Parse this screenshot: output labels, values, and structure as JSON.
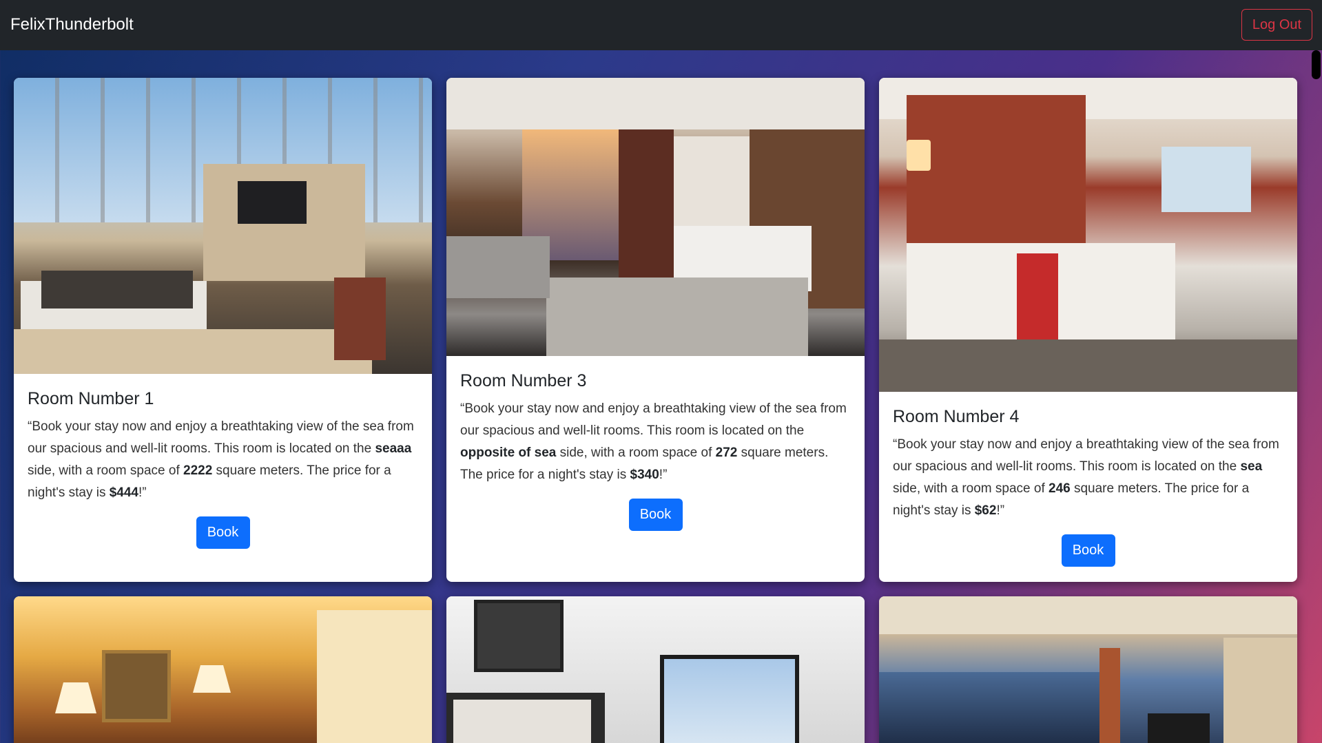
{
  "navbar": {
    "brand": "FelixThunderbolt",
    "logout_label": "Log Out"
  },
  "accent_colors": {
    "primary": "#0d6efd",
    "danger": "#dc3545",
    "navbar": "#212529"
  },
  "rooms": [
    {
      "title": "Room Number 1",
      "text_a": "“Book your stay now and enjoy a breathtaking view of the sea from our spacious and well-lit rooms. This room is located on the ",
      "side": "seaaa",
      "text_b": " side, with a room space of ",
      "space": "2222",
      "text_c": " square meters. The price for a night's stay is ",
      "price": "$444",
      "text_d": "!”",
      "button": "Book"
    },
    {
      "title": "Room Number 3",
      "text_a": "“Book your stay now and enjoy a breathtaking view of the sea from our spacious and well-lit rooms. This room is located on the ",
      "side": "opposite of sea",
      "text_b": " side, with a room space of ",
      "space": "272",
      "text_c": " square meters. The price for a night's stay is ",
      "price": "$340",
      "text_d": "!”",
      "button": "Book"
    },
    {
      "title": "Room Number 4",
      "text_a": "“Book your stay now and enjoy a breathtaking view of the sea from our spacious and well-lit rooms. This room is located on the ",
      "side": "sea",
      "text_b": " side, with a room space of ",
      "space": "246",
      "text_c": " square meters. The price for a night's stay is ",
      "price": "$62",
      "text_d": "!”",
      "button": "Book"
    }
  ]
}
